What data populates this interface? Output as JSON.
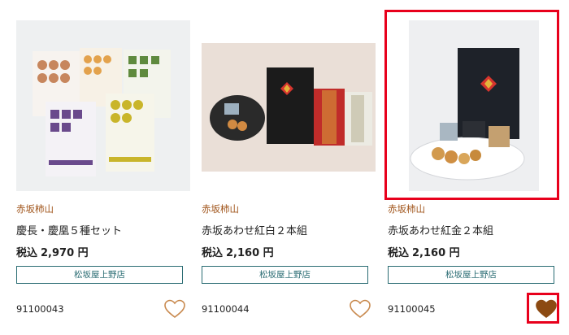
{
  "products": [
    {
      "brand": "赤坂柿山",
      "name": "慶長・慶凰５種セット",
      "price_label": "税込",
      "price": "2,970 円",
      "store_button": "松坂屋上野店",
      "code": "91100043",
      "favorited": false,
      "image": "five-bag-snack-set-image"
    },
    {
      "brand": "赤坂柿山",
      "name": "赤坂あわせ紅白２本組",
      "price_label": "税込",
      "price": "2,160 円",
      "store_button": "松坂屋上野店",
      "code": "91100044",
      "favorited": false,
      "image": "boxed-gift-with-plate-image"
    },
    {
      "brand": "赤坂柿山",
      "name": "赤坂あわせ紅金２本組",
      "price_label": "税込",
      "price": "2,160 円",
      "store_button": "松坂屋上野店",
      "code": "91100045",
      "favorited": true,
      "image": "black-box-with-plate-image"
    }
  ],
  "colors": {
    "brand_text": "#a0541a",
    "button_border": "#2a6c73",
    "heart_outline": "#c98a4f",
    "heart_filled": "#8c4a12",
    "highlight": "#e8001c"
  }
}
